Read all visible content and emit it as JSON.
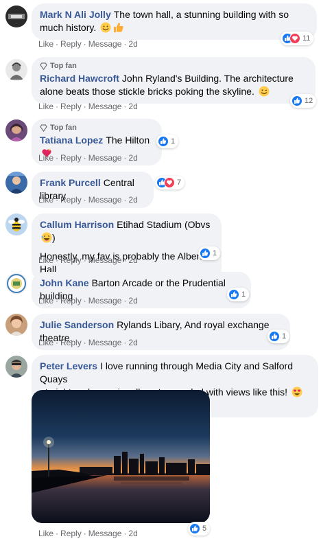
{
  "actions": {
    "like": "Like",
    "reply": "Reply",
    "message": "Message",
    "sep": "·"
  },
  "badge": {
    "top_fan": "Top fan"
  },
  "comments": [
    {
      "author": "Mark N Ali Jolly",
      "text": "The town hall, a stunning building with so much history.",
      "reactions": "11",
      "time": "2d",
      "emojis": [
        "smiling-face-icon",
        "thumbs-up-icon"
      ]
    },
    {
      "author": "Richard Hawcroft",
      "text": "John Ryland's Building. The architecture alone beats those stickle bricks poking the skyline.",
      "reactions": "12",
      "time": "2d",
      "top_fan": true,
      "emojis": [
        "winking-face-icon"
      ]
    },
    {
      "author": "Tatiana Lopez",
      "text": "The Hilton",
      "reactions": "1",
      "time": "2d",
      "top_fan": true,
      "emojis": [
        "sparkling-heart-icon"
      ]
    },
    {
      "author": "Frank Purcell",
      "text": "Central library",
      "reactions": "7",
      "time": "2d"
    },
    {
      "author": "Callum Harrison",
      "text": "Etihad Stadium (Obvs",
      "text_end": ")",
      "text2": "Honestly, my fav is probably the Albert Hall",
      "reactions": "1",
      "time": "2d",
      "emojis": [
        "laughing-face-icon"
      ]
    },
    {
      "author": "John Kane",
      "text": "Barton Arcade or the Prudential building",
      "reactions": "1",
      "time": "2d"
    },
    {
      "author": "Julie Sanderson",
      "text": "Rylands Libary, And royal exchange theatre.",
      "reactions": "1",
      "time": "2d"
    },
    {
      "author": "Peter Levers",
      "text": "I love running through Media City and Salford Quays",
      "text_line2": "at night and occasionally get rewarded with views like this!",
      "reactions": "5",
      "time": "2d",
      "emojis": [
        "heart-eyes-face-icon",
        "night-city-icon"
      ]
    }
  ],
  "colors": {
    "author": "#385898",
    "bubble": "#f0f2f5",
    "like": "#1877f2",
    "love": "#f33e58",
    "meta": "#65676b"
  }
}
